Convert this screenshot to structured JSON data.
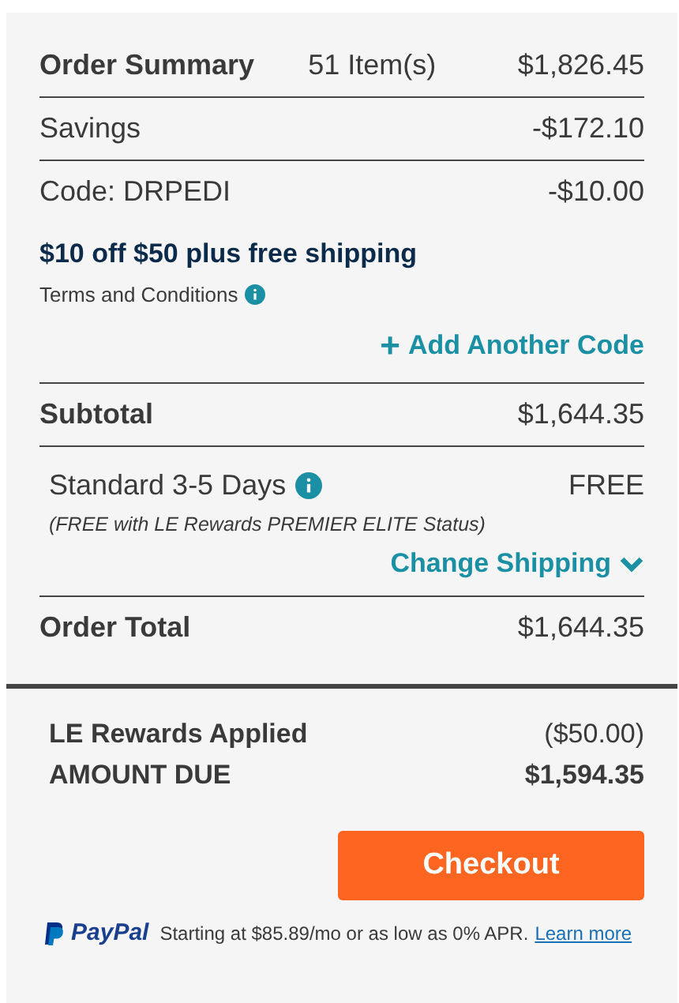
{
  "summary": {
    "title": "Order Summary",
    "items": "51 Item(s)",
    "amount": "$1,826.45"
  },
  "savings": {
    "label": "Savings",
    "amount": "-$172.10"
  },
  "code": {
    "label": "Code: DRPEDI",
    "amount": "-$10.00",
    "promo": "$10 off $50 plus free shipping",
    "terms": "Terms and Conditions"
  },
  "add_code": {
    "icon": "+",
    "label": "Add Another Code"
  },
  "subtotal": {
    "label": "Subtotal",
    "amount": "$1,644.35"
  },
  "shipping": {
    "label": "Standard 3-5 Days",
    "amount": "FREE",
    "note": "(FREE with LE Rewards PREMIER ELITE Status)",
    "change": "Change Shipping",
    "expanded": false
  },
  "order_total": {
    "label": "Order Total",
    "amount": "$1,644.35"
  },
  "rewards": {
    "label": "LE Rewards Applied",
    "amount": "($50.00)"
  },
  "amount_due": {
    "label": "AMOUNT DUE",
    "amount": "$1,594.35"
  },
  "checkout": {
    "label": "Checkout"
  },
  "paypal": {
    "brand": "PayPal",
    "text": "Starting at $85.89/mo or as low as 0% APR.",
    "link": "Learn more"
  }
}
